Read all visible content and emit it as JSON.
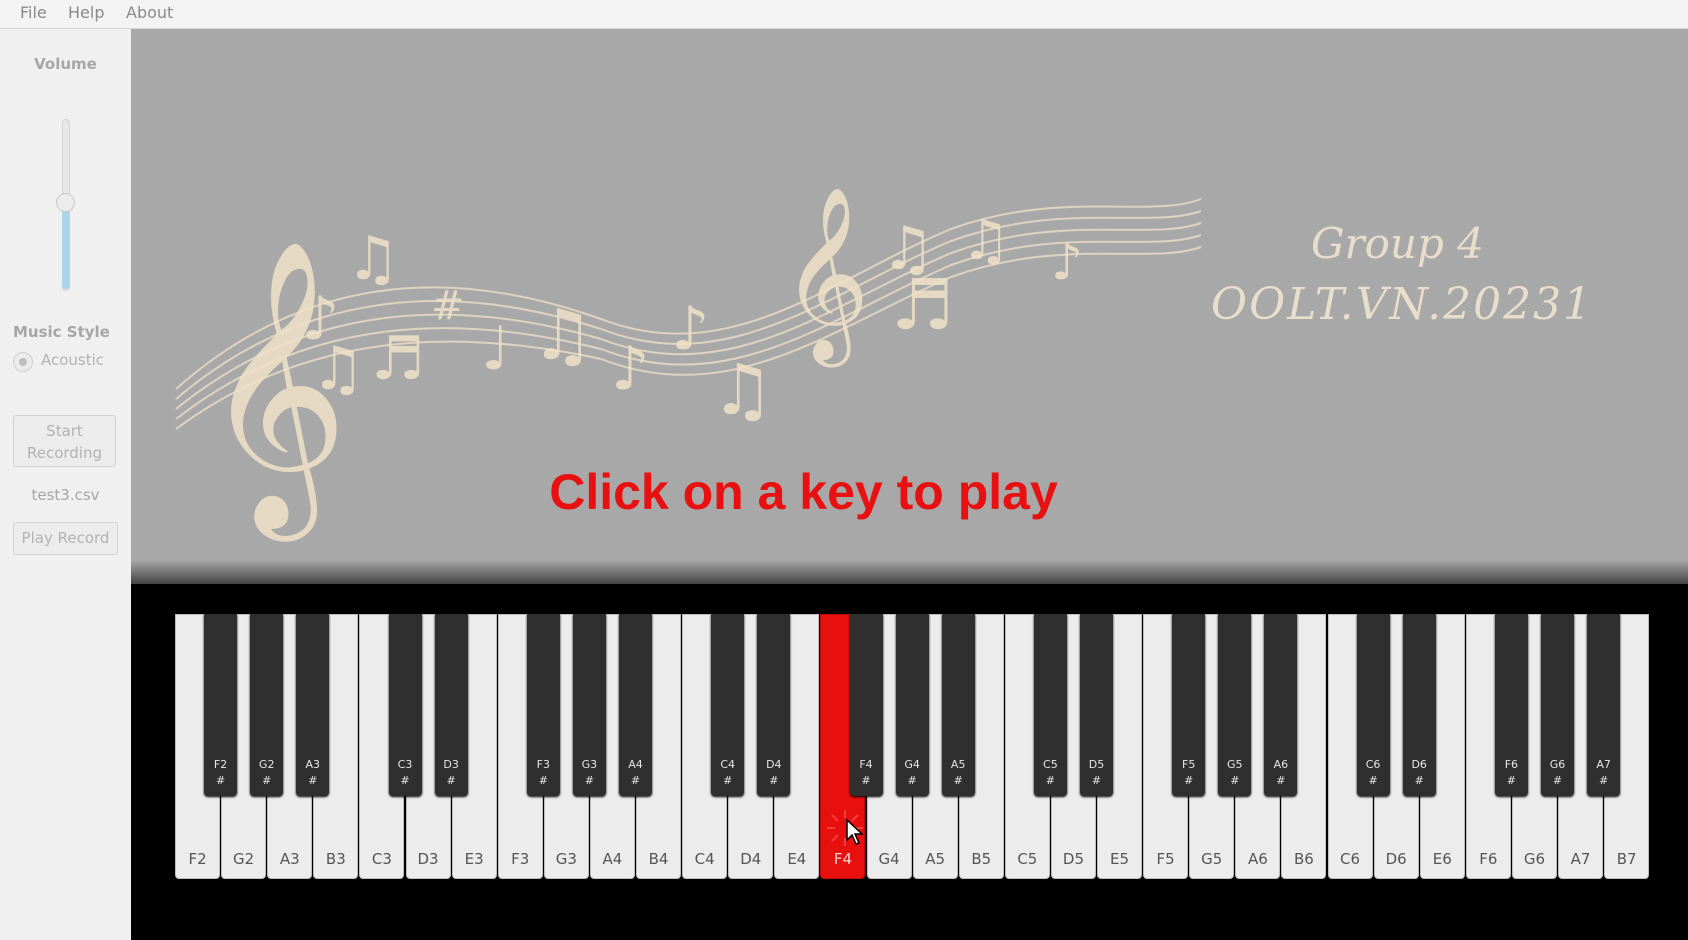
{
  "menu": {
    "file": "File",
    "help": "Help",
    "about": "About"
  },
  "sidebar": {
    "volume_label": "Volume",
    "volume_level_percent": 52,
    "music_style_label": "Music Style",
    "style_option": "Acoustic",
    "start_recording_label": "Start\nRecording",
    "file_name": "test3.csv",
    "play_record_label": "Play Record"
  },
  "banner": {
    "line1": "Group 4",
    "line2": "OOLT.VN.20231",
    "colors": {
      "notes": "#f1e2c8",
      "background": "#a8a8a8"
    }
  },
  "prompt": {
    "text": "Click on a key to play",
    "color": "#e81010"
  },
  "keyboard": {
    "white_keys": [
      "F2",
      "G2",
      "A3",
      "B3",
      "C3",
      "D3",
      "E3",
      "F3",
      "G3",
      "A4",
      "B4",
      "C4",
      "D4",
      "E4",
      "F4",
      "G4",
      "A5",
      "B5",
      "C5",
      "D5",
      "E5",
      "F5",
      "G5",
      "A6",
      "B6",
      "C6",
      "D6",
      "E6",
      "F6",
      "G6",
      "A7",
      "B7"
    ],
    "black_keys": [
      "F2",
      "G2",
      "A3",
      "C3",
      "D3",
      "F3",
      "G3",
      "A4",
      "C4",
      "D4",
      "F4",
      "G4",
      "A5",
      "C5",
      "D5",
      "F5",
      "G5",
      "A6",
      "C6",
      "D6",
      "F6",
      "G6",
      "A7"
    ],
    "sharp_symbol": "#",
    "active_key": "F4",
    "active_color": "#e80f0f"
  },
  "icons": {
    "cursor": "pointer-cursor-icon",
    "click_burst": "click-burst-icon"
  }
}
